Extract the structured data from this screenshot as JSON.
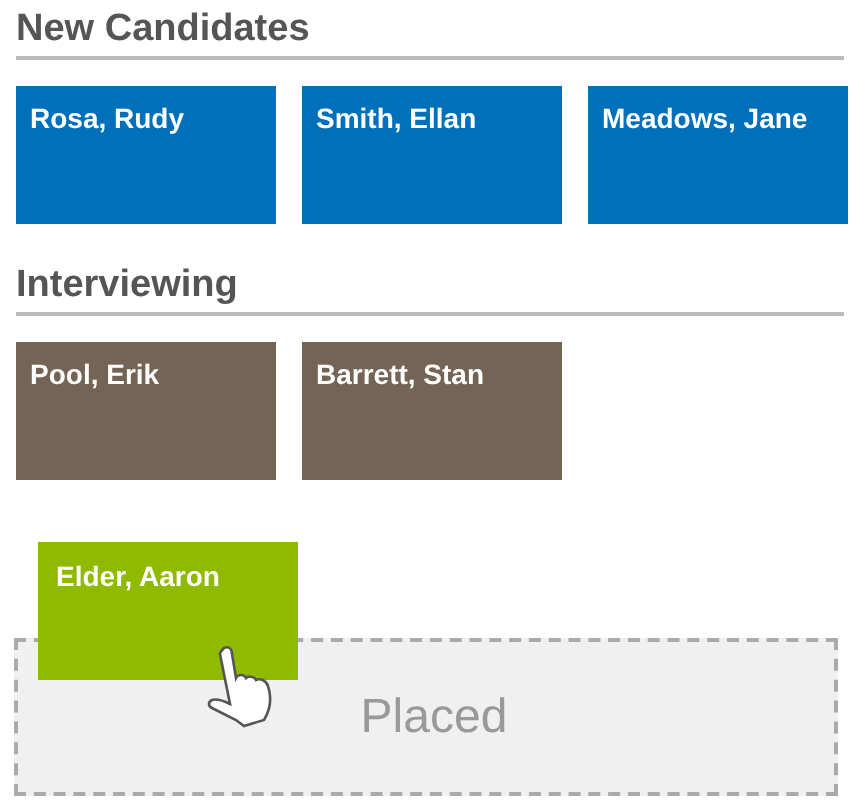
{
  "sections": [
    {
      "title": "New Candidates",
      "cards": [
        {
          "name": "Rosa, Rudy",
          "color": "#0070ba"
        },
        {
          "name": "Smith, Ellan",
          "color": "#0070ba"
        },
        {
          "name": "Meadows, Jane",
          "color": "#0070ba"
        }
      ]
    },
    {
      "title": "Interviewing",
      "cards": [
        {
          "name": "Pool, Erik",
          "color": "#746455"
        },
        {
          "name": "Barrett, Stan",
          "color": "#746455"
        }
      ]
    }
  ],
  "drop_zone": {
    "label": "Placed"
  },
  "dragged_card": {
    "name": "Elder, Aaron",
    "color": "#8fba00"
  }
}
